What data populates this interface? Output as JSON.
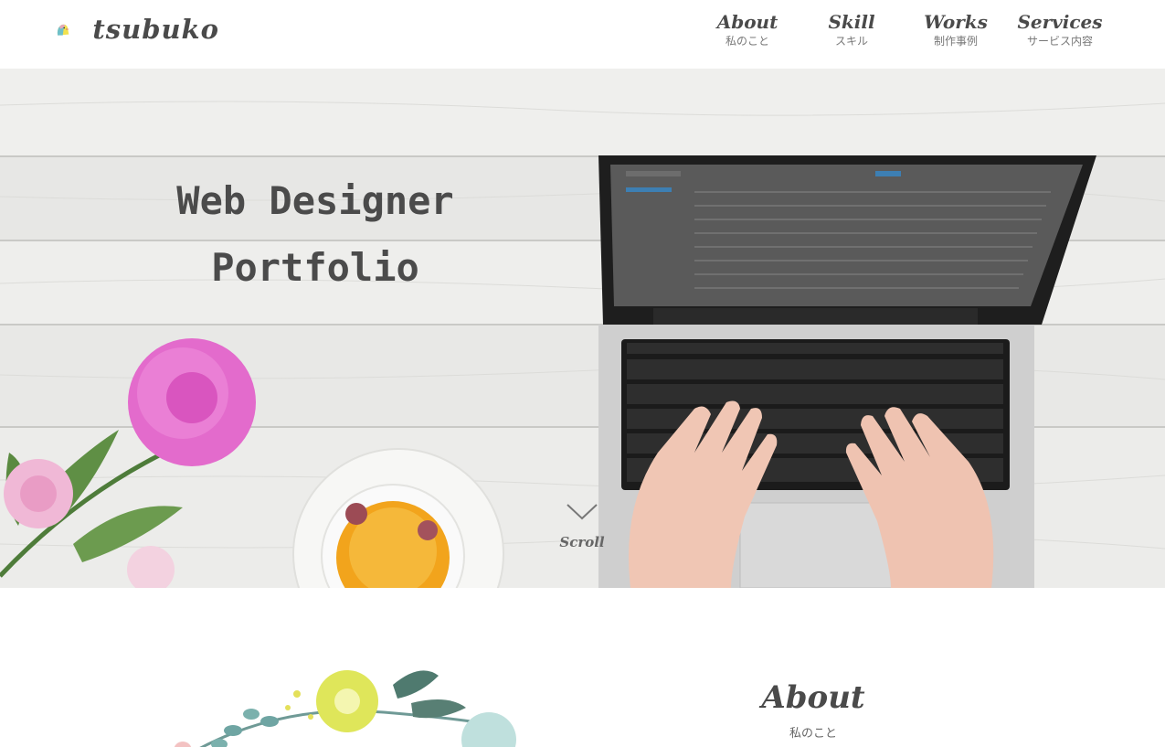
{
  "site": {
    "logo_text": "tsubuko",
    "logo_icon": "bird-icon"
  },
  "nav": {
    "items": [
      {
        "en": "About",
        "ja": "私のこと"
      },
      {
        "en": "Skill",
        "ja": "スキル"
      },
      {
        "en": "Works",
        "ja": "制作事例"
      },
      {
        "en": "Services",
        "ja": "サービス内容"
      }
    ]
  },
  "hero": {
    "title_line1": "Web Designer",
    "title_line2": "Portfolio",
    "scroll_label": "Scroll",
    "scroll_icon": "chevron-down-icon"
  },
  "about": {
    "heading_en": "About",
    "heading_ja": "私のこと"
  },
  "colors": {
    "text_dark": "#4a4a4a",
    "text_muted": "#777777",
    "background": "#ffffff",
    "hero_wood": "#e9e9e7"
  }
}
